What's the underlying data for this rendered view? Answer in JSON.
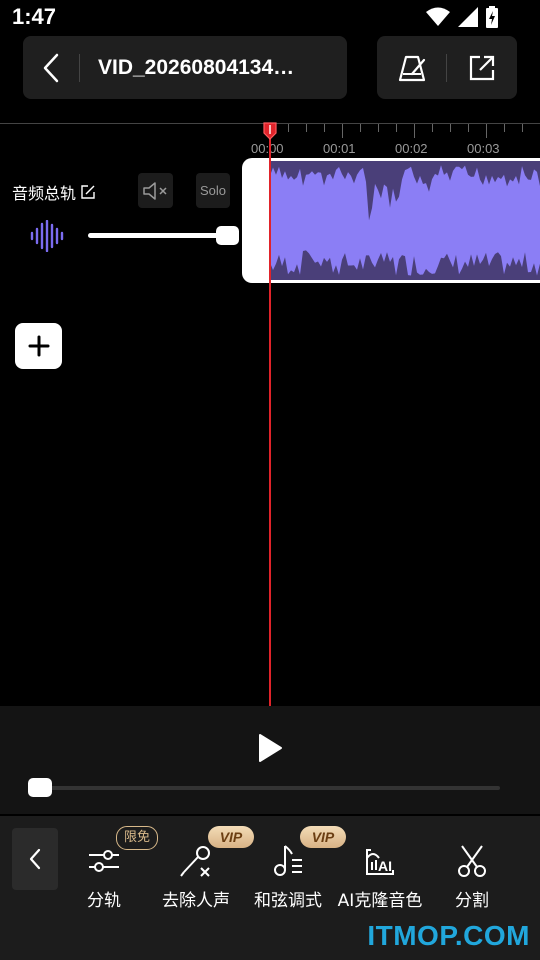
{
  "status": {
    "time": "1:47"
  },
  "header": {
    "title": "VID_20260804134…"
  },
  "timeline": {
    "ticks": [
      "00:00",
      "00:01",
      "00:02",
      "00:03"
    ]
  },
  "track": {
    "name": "音频总轨",
    "solo_label": "Solo",
    "volume": 1.0,
    "wave_color": "#7b6cf0",
    "clip_wave_color": "#8b7ef5"
  },
  "player": {
    "progress": 0.0
  },
  "toolbar": {
    "items": [
      {
        "label": "分轨",
        "icon": "split-track-icon",
        "badge": "限免"
      },
      {
        "label": "去除人声",
        "icon": "remove-vocal-icon",
        "badge": "VIP"
      },
      {
        "label": "和弦调式",
        "icon": "chord-mode-icon",
        "badge": "VIP"
      },
      {
        "label": "AI克隆音色",
        "icon": "ai-clone-icon",
        "badge": ""
      },
      {
        "label": "分割",
        "icon": "scissors-icon",
        "badge": ""
      }
    ]
  },
  "watermark": "ITMOP.COM",
  "colors": {
    "accent": "#e0232a",
    "vip_gold": "#d8b98a",
    "watermark": "#21a7dc"
  }
}
